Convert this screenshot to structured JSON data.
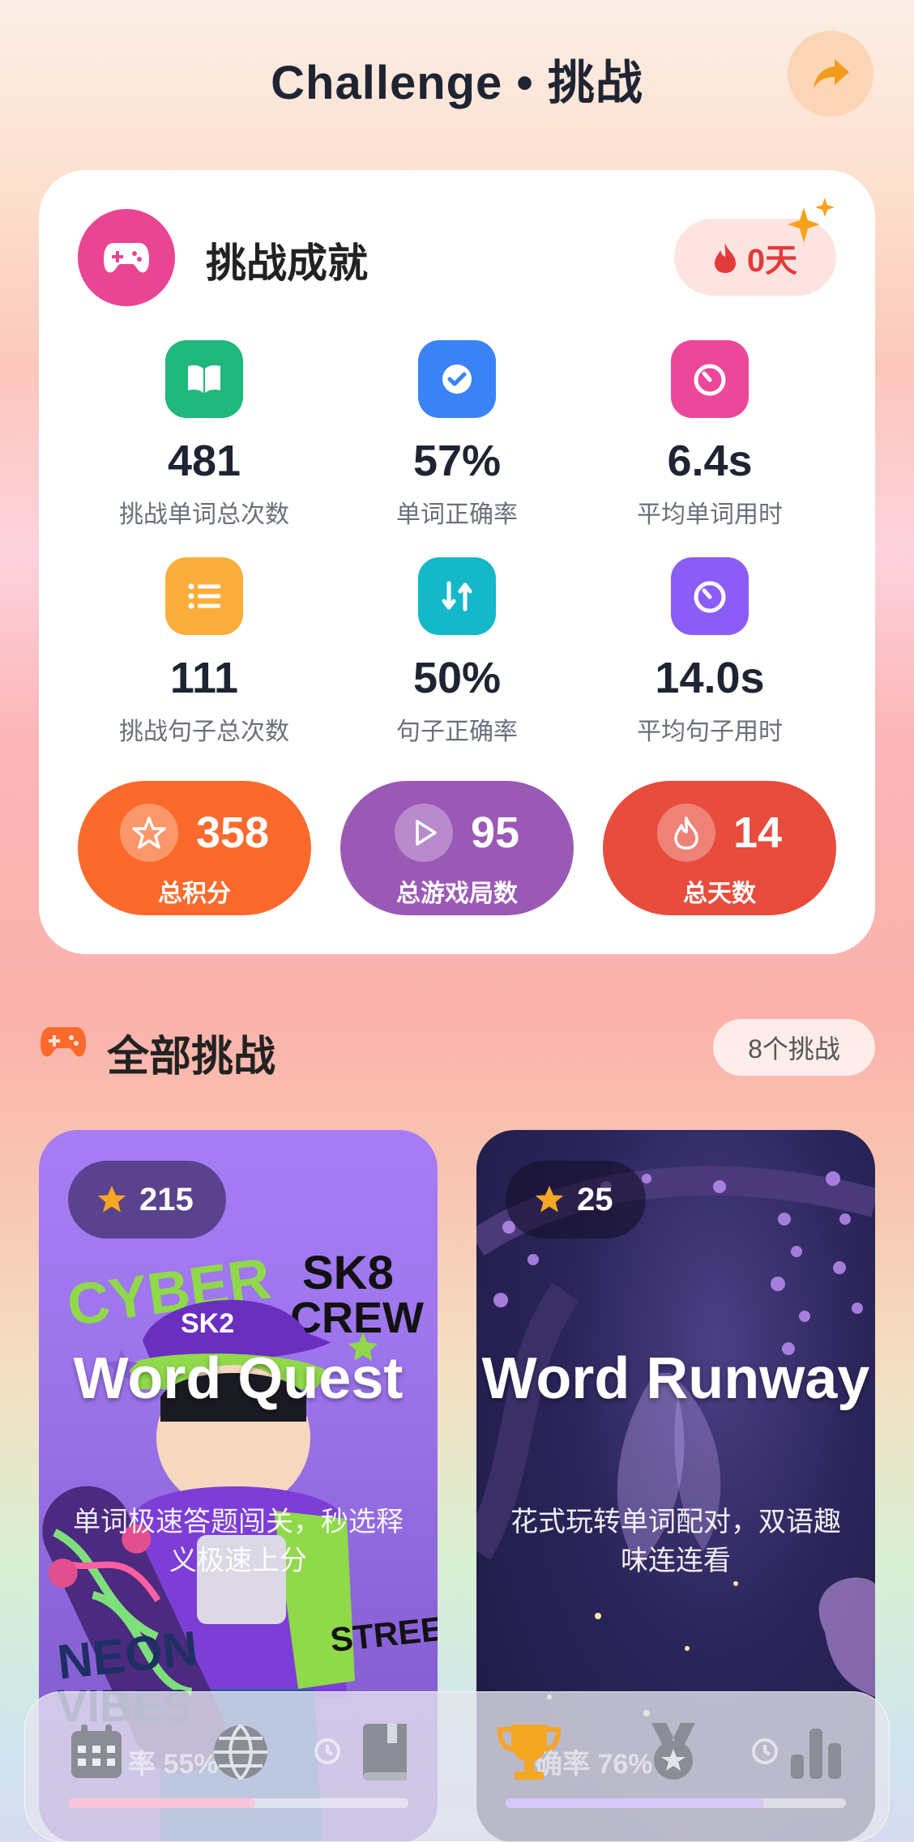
{
  "header": {
    "title": "Challenge • 挑战"
  },
  "achievement": {
    "title": "挑战成就",
    "streak": "0天",
    "stats": [
      {
        "value": "481",
        "label": "挑战单词总次数",
        "icon": "book-icon",
        "color": "#1fb77b"
      },
      {
        "value": "57%",
        "label": "单词正确率",
        "icon": "check-icon",
        "color": "#3b82f6"
      },
      {
        "value": "6.4s",
        "label": "平均单词用时",
        "icon": "timer-icon",
        "color": "#ec4899"
      },
      {
        "value": "111",
        "label": "挑战句子总次数",
        "icon": "list-icon",
        "color": "#fbae3c"
      },
      {
        "value": "50%",
        "label": "句子正确率",
        "icon": "swap-icon",
        "color": "#14b8c8"
      },
      {
        "value": "14.0s",
        "label": "平均句子用时",
        "icon": "timer-icon",
        "color": "#8b5cf6"
      }
    ],
    "totals": [
      {
        "value": "358",
        "label": "总积分",
        "icon": "star-icon",
        "color": "#fb6a2c"
      },
      {
        "value": "95",
        "label": "总游戏局数",
        "icon": "play-icon",
        "color": "#9b59b6"
      },
      {
        "value": "14",
        "label": "总天数",
        "icon": "flame-icon",
        "color": "#e74c3c"
      }
    ]
  },
  "section": {
    "title": "全部挑战",
    "count": "8个挑战"
  },
  "games": [
    {
      "score": "215",
      "title": "Word Quest",
      "desc": "单词极速答题闯关，秒选释义极速上分",
      "overlay": "率 55%",
      "progress": 0.55,
      "bar_color": "#f9c5d8"
    },
    {
      "score": "25",
      "title": "Word Runway",
      "desc": "花式玩转单词配对，双语趣味连连看",
      "overlay": "确率 76%",
      "progress": 0.76,
      "bar_color": "#d6c8f7"
    }
  ],
  "poster_text": [
    "CYBER",
    "SK8",
    "CREW",
    "SK2",
    "NEON",
    "VIBES",
    "STREET"
  ],
  "nav": [
    {
      "icon": "calendar-icon"
    },
    {
      "icon": "globe-icon"
    },
    {
      "icon": "book-icon"
    },
    {
      "icon": "trophy-icon",
      "active": true
    },
    {
      "icon": "medal-icon"
    },
    {
      "icon": "bar-chart-icon"
    }
  ],
  "colors": {
    "accent": "#f5a623",
    "brand_pink": "#e94593"
  }
}
